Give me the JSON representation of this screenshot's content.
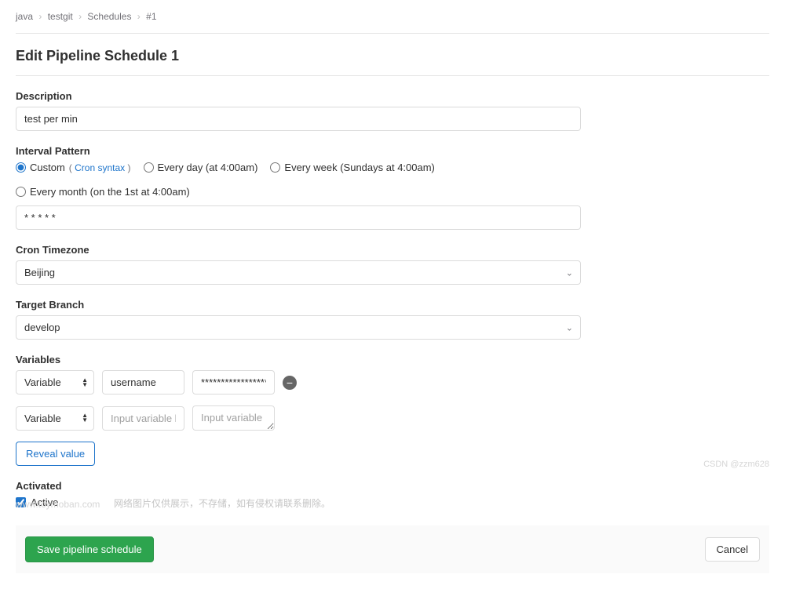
{
  "breadcrumb": {
    "items": [
      "java",
      "testgit",
      "Schedules",
      "#1"
    ]
  },
  "page_title": "Edit Pipeline Schedule 1",
  "description": {
    "label": "Description",
    "value": "test per min"
  },
  "interval": {
    "label": "Interval Pattern",
    "options": {
      "custom": "Custom",
      "cron_link": "Cron syntax",
      "daily": "Every day (at 4:00am)",
      "weekly": "Every week (Sundays at 4:00am)",
      "monthly": "Every month (on the 1st at 4:00am)"
    },
    "selected": "custom",
    "value": "* * * * *"
  },
  "timezone": {
    "label": "Cron Timezone",
    "value": "Beijing"
  },
  "branch": {
    "label": "Target Branch",
    "value": "develop"
  },
  "variables": {
    "label": "Variables",
    "type_label": "Variable",
    "key_placeholder": "Input variable key",
    "value_placeholder": "Input variable",
    "rows": [
      {
        "key": "username",
        "value": "*****************"
      },
      {
        "key": "",
        "value": ""
      }
    ]
  },
  "reveal_button": "Reveal value",
  "activated": {
    "label": "Activated",
    "checkbox_label": "Active",
    "checked": true
  },
  "actions": {
    "save": "Save pipeline schedule",
    "cancel": "Cancel"
  },
  "watermarks": {
    "left": "www.toymoban.com",
    "center": "网络图片仅供展示，不存储，如有侵权请联系删除。",
    "right": "CSDN @zzm628"
  }
}
